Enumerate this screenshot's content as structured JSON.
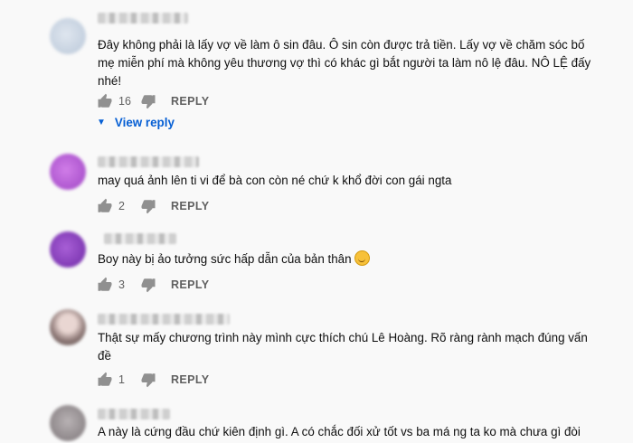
{
  "colors": {
    "link": "#065fd4",
    "muted": "#606060",
    "text": "#0f0f0f",
    "background": "#f9f9f9"
  },
  "comments": [
    {
      "text": "Đây không phải là lấy vợ về làm ô sin đâu. Ô sin còn được trả tiền. Lấy vợ về chăm sóc bố mẹ miễn phí mà không yêu thương vợ thì có khác gì bắt người ta làm nô lệ đâu. NÔ LỆ đấy nhé!",
      "likes": "16",
      "reply_label": "REPLY",
      "view_reply_label": "View reply"
    },
    {
      "text": "may quá ảnh lên ti vi để bà con còn né chứ k khổ đời con gái ngta",
      "likes": "2",
      "reply_label": "REPLY"
    },
    {
      "text": "Boy này bị ảo tưởng sức hấp dẫn của bản thân",
      "emoji": "rolling-on-floor-laughing-emoji",
      "likes": "3",
      "reply_label": "REPLY"
    },
    {
      "text": "Thật sự mấy chương trình này mình cực thích chú Lê Hoàng. Rõ ràng rành mạch đúng  vấn đề",
      "likes": "1",
      "reply_label": "REPLY"
    },
    {
      "text": "A này là cứng đầu chứ kiên định gì. A có chắc đối xử tốt vs ba má ng ta ko mà chưa gì đòi"
    }
  ]
}
